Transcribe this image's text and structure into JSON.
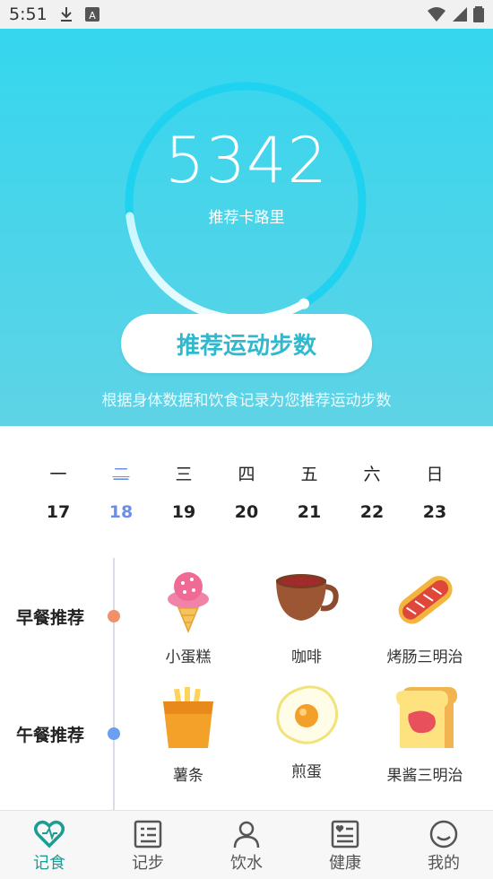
{
  "status_bar": {
    "time": "5:51"
  },
  "hero": {
    "calories": "5342",
    "calories_label": "推荐卡路里",
    "button_label": "推荐运动步数",
    "description": "根据身体数据和饮食记录为您推荐运动步数",
    "ring_progress": 0.7
  },
  "week": {
    "days": [
      {
        "weekday": "一",
        "date": "17"
      },
      {
        "weekday": "二",
        "date": "18"
      },
      {
        "weekday": "三",
        "date": "19"
      },
      {
        "weekday": "四",
        "date": "20"
      },
      {
        "weekday": "五",
        "date": "21"
      },
      {
        "weekday": "六",
        "date": "22"
      },
      {
        "weekday": "日",
        "date": "23"
      }
    ],
    "selected_index": 1
  },
  "meals": [
    {
      "label": "早餐推荐",
      "dot_color": "#f0916a",
      "foods": [
        {
          "name": "小蛋糕",
          "icon": "ice-cream-icon"
        },
        {
          "name": "咖啡",
          "icon": "coffee-cup-icon"
        },
        {
          "name": "烤肠三明治",
          "icon": "hotdog-icon"
        }
      ]
    },
    {
      "label": "午餐推荐",
      "dot_color": "#6b9ff0",
      "foods": [
        {
          "name": "薯条",
          "icon": "fries-icon"
        },
        {
          "name": "煎蛋",
          "icon": "fried-egg-icon"
        },
        {
          "name": "果酱三明治",
          "icon": "jam-toast-icon"
        }
      ]
    }
  ],
  "tabbar": {
    "tabs": [
      {
        "label": "记食",
        "icon": "heart-icon",
        "active": true
      },
      {
        "label": "记步",
        "icon": "list-icon",
        "active": false
      },
      {
        "label": "饮水",
        "icon": "person-icon",
        "active": false
      },
      {
        "label": "健康",
        "icon": "health-list-icon",
        "active": false
      },
      {
        "label": "我的",
        "icon": "smile-icon",
        "active": false
      }
    ]
  },
  "colors": {
    "accent": "#35d6ee",
    "tab_active": "#1a9e93",
    "selected_day": "#6b8fe8"
  }
}
